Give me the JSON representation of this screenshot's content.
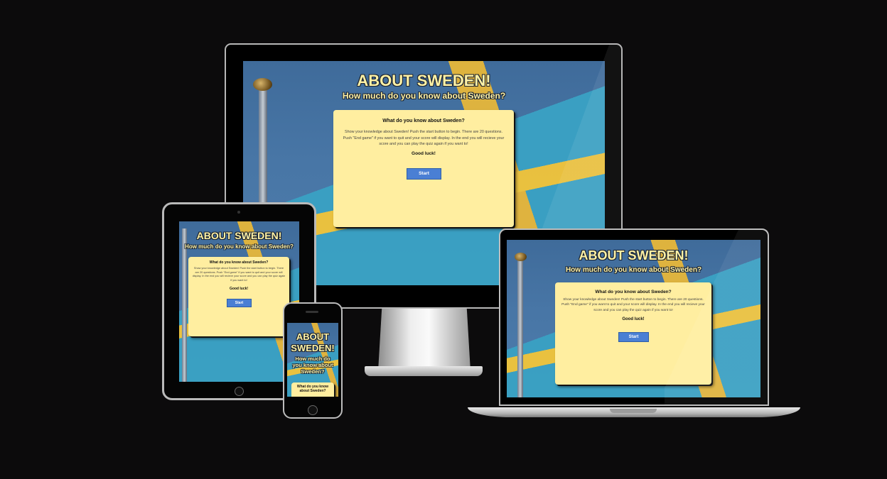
{
  "app": {
    "title": "ABOUT SWEDEN!",
    "title_split": [
      "ABOUT",
      "SWEDEN!"
    ],
    "subtitle": "How much do you know about Sweden?",
    "subtitle_split": [
      "How much do",
      "you know about",
      "Sweden?"
    ]
  },
  "card": {
    "heading": "What do you know about Sweden?",
    "heading_split": [
      "What do you know",
      "about Sweden?"
    ],
    "body": "Show your knowledge about Sweden! Push the start button to begin. There are 20 questions. Push \"End game\" if you want to quit and your score will display. In the end you will recieve your score and you can play the quiz again if you want to!",
    "good_luck": "Good luck!",
    "start_label": "Start"
  },
  "colors": {
    "title": "#fff2a6",
    "card": "#ffeea0",
    "button": "#4a7fd4",
    "sky": "#4876a6",
    "flag_blue": "#3aa2c4",
    "flag_yellow": "#f2c53a"
  },
  "devices": [
    "desktop-monitor",
    "tablet",
    "phone",
    "laptop"
  ]
}
